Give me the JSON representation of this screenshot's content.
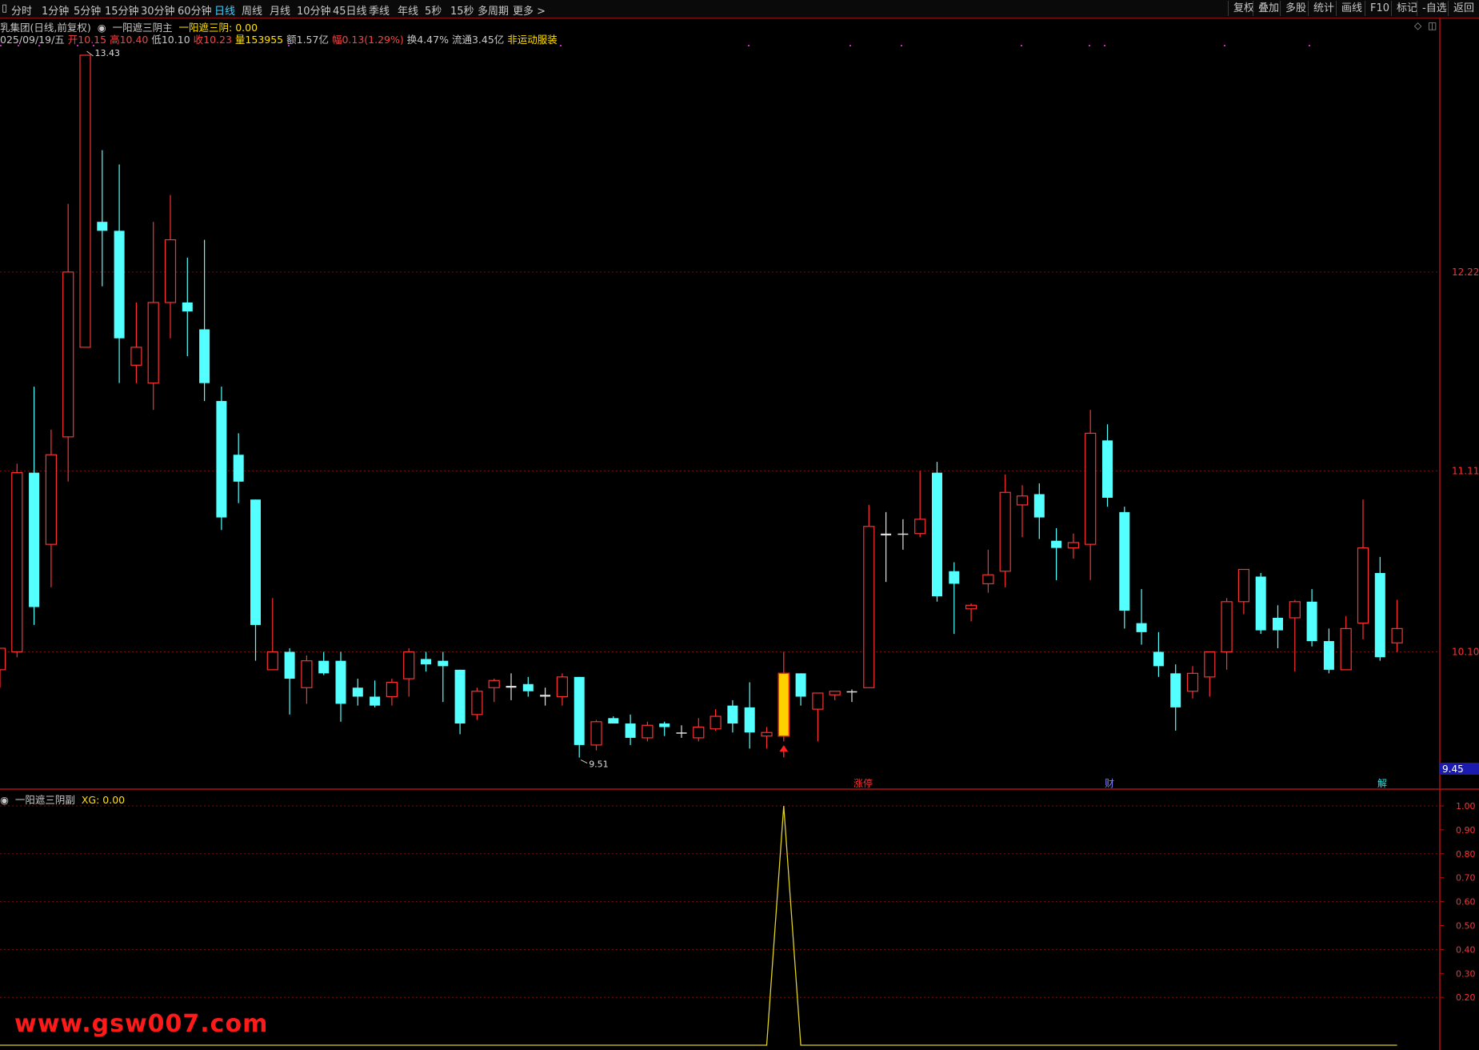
{
  "toolbar": {
    "tabs": [
      "分时",
      "1分钟",
      "5分钟",
      "15分钟",
      "30分钟",
      "60分钟",
      "日线",
      "周线",
      "月线",
      "10分钟",
      "45日线",
      "季线",
      "年线",
      "5秒",
      "15秒",
      "多周期",
      "更多 >"
    ],
    "active_tab": "日线",
    "right_buttons": [
      "复权",
      "叠加",
      "多股",
      "统计",
      "画线",
      "F10",
      "标记",
      "-自选",
      "返回"
    ]
  },
  "header": {
    "title": "乳集团(日线,前复权)",
    "indicator_main": "一阳遮三阴主",
    "indicator_value_label": "一阳遮三阴: 0.00",
    "date": "025/09/19/五",
    "open_label": "开10.15",
    "high_label": "高10.40",
    "low_label": "低10.10",
    "close_label": "收10.23",
    "volume_label": "量153955",
    "amount_label": "额1.57亿",
    "change_label": "幅0.13(1.29%)",
    "turnover_label": "换4.47%",
    "float_label": "流通3.45亿",
    "concept_label": "非运动服装"
  },
  "price_axis": {
    "labels": [
      "12.22",
      "11.11",
      "10.10"
    ],
    "current_price_tag": "9.45",
    "max_marker": "13.43",
    "min_marker": "9.51"
  },
  "event_tags": [
    "涨停",
    "财",
    "解"
  ],
  "sub_panel": {
    "title": "一阳遮三阴副",
    "value_label": "XG: 0.00",
    "axis_labels": [
      "1.00",
      "0.90",
      "0.80",
      "0.70",
      "0.60",
      "0.50",
      "0.40",
      "0.30",
      "0.20"
    ]
  },
  "watermark": "www.gsw007.com",
  "colors": {
    "up": "#ff3030",
    "down": "#54ffff",
    "signal": "#ffd000",
    "grid": "#7a0e0e"
  },
  "chart_data": {
    "type": "candlestick",
    "price_range": [
      9.3,
      13.5
    ],
    "candles": [
      {
        "o": 10.0,
        "h": 10.12,
        "l": 9.9,
        "c": 10.12
      },
      {
        "o": 10.1,
        "h": 11.15,
        "l": 10.07,
        "c": 11.1
      },
      {
        "o": 11.1,
        "h": 11.58,
        "l": 10.25,
        "c": 10.35
      },
      {
        "o": 10.7,
        "h": 11.34,
        "l": 10.46,
        "c": 11.2
      },
      {
        "o": 11.3,
        "h": 12.6,
        "l": 11.05,
        "c": 12.22
      },
      {
        "o": 11.8,
        "h": 13.43,
        "l": 11.8,
        "c": 13.43
      },
      {
        "o": 12.5,
        "h": 12.9,
        "l": 12.14,
        "c": 12.45
      },
      {
        "o": 12.45,
        "h": 12.82,
        "l": 11.6,
        "c": 11.85
      },
      {
        "o": 11.7,
        "h": 12.05,
        "l": 11.6,
        "c": 11.8
      },
      {
        "o": 11.6,
        "h": 12.5,
        "l": 11.45,
        "c": 12.05
      },
      {
        "o": 12.05,
        "h": 12.65,
        "l": 11.85,
        "c": 12.4
      },
      {
        "o": 12.05,
        "h": 12.3,
        "l": 11.75,
        "c": 12.0
      },
      {
        "o": 11.9,
        "h": 12.4,
        "l": 11.5,
        "c": 11.6
      },
      {
        "o": 11.5,
        "h": 11.58,
        "l": 10.78,
        "c": 10.85
      },
      {
        "o": 11.2,
        "h": 11.32,
        "l": 10.93,
        "c": 11.05
      },
      {
        "o": 10.95,
        "h": 10.95,
        "l": 10.05,
        "c": 10.25
      },
      {
        "o": 10.0,
        "h": 10.4,
        "l": 10.0,
        "c": 10.1
      },
      {
        "o": 10.1,
        "h": 10.12,
        "l": 9.75,
        "c": 9.95
      },
      {
        "o": 9.9,
        "h": 10.08,
        "l": 9.81,
        "c": 10.05
      },
      {
        "o": 10.05,
        "h": 10.1,
        "l": 9.97,
        "c": 9.98
      },
      {
        "o": 10.05,
        "h": 10.1,
        "l": 9.71,
        "c": 9.81
      },
      {
        "o": 9.9,
        "h": 9.95,
        "l": 9.8,
        "c": 9.85
      },
      {
        "o": 9.85,
        "h": 9.94,
        "l": 9.79,
        "c": 9.8
      },
      {
        "o": 9.85,
        "h": 9.95,
        "l": 9.8,
        "c": 9.93
      },
      {
        "o": 9.95,
        "h": 10.12,
        "l": 9.85,
        "c": 10.1
      },
      {
        "o": 10.06,
        "h": 10.1,
        "l": 9.99,
        "c": 10.03
      },
      {
        "o": 10.05,
        "h": 10.1,
        "l": 9.82,
        "c": 10.02
      },
      {
        "o": 10.0,
        "h": 10.0,
        "l": 9.64,
        "c": 9.7
      },
      {
        "o": 9.75,
        "h": 9.9,
        "l": 9.72,
        "c": 9.88
      },
      {
        "o": 9.9,
        "h": 9.95,
        "l": 9.82,
        "c": 9.94
      },
      {
        "o": 9.9,
        "h": 9.98,
        "l": 9.83,
        "c": 9.91
      },
      {
        "o": 9.92,
        "h": 9.96,
        "l": 9.85,
        "c": 9.88
      },
      {
        "o": 9.85,
        "h": 9.9,
        "l": 9.8,
        "c": 9.86
      },
      {
        "o": 9.85,
        "h": 9.98,
        "l": 9.8,
        "c": 9.96
      },
      {
        "o": 9.96,
        "h": 9.96,
        "l": 9.51,
        "c": 9.58
      },
      {
        "o": 9.58,
        "h": 9.72,
        "l": 9.55,
        "c": 9.71
      },
      {
        "o": 9.73,
        "h": 9.74,
        "l": 9.7,
        "c": 9.7
      },
      {
        "o": 9.7,
        "h": 9.75,
        "l": 9.58,
        "c": 9.62
      },
      {
        "o": 9.62,
        "h": 9.71,
        "l": 9.6,
        "c": 9.69
      },
      {
        "o": 9.7,
        "h": 9.71,
        "l": 9.63,
        "c": 9.68
      },
      {
        "o": 9.65,
        "h": 9.69,
        "l": 9.62,
        "c": 9.65
      },
      {
        "o": 9.62,
        "h": 9.73,
        "l": 9.6,
        "c": 9.68
      },
      {
        "o": 9.67,
        "h": 9.78,
        "l": 9.66,
        "c": 9.74
      },
      {
        "o": 9.8,
        "h": 9.83,
        "l": 9.65,
        "c": 9.7
      },
      {
        "o": 9.79,
        "h": 9.93,
        "l": 9.56,
        "c": 9.65
      },
      {
        "o": 9.63,
        "h": 9.68,
        "l": 9.56,
        "c": 9.65
      },
      {
        "o": 9.63,
        "h": 10.1,
        "l": 9.6,
        "c": 9.98,
        "highlight": true
      },
      {
        "o": 9.98,
        "h": 9.98,
        "l": 9.8,
        "c": 9.85
      },
      {
        "o": 9.78,
        "h": 9.87,
        "l": 9.6,
        "c": 9.87
      },
      {
        "o": 9.86,
        "h": 9.88,
        "l": 9.83,
        "c": 9.88
      },
      {
        "o": 9.88,
        "h": 9.89,
        "l": 9.82,
        "c": 9.88
      },
      {
        "o": 9.9,
        "h": 10.92,
        "l": 9.9,
        "c": 10.8
      },
      {
        "o": 10.76,
        "h": 10.88,
        "l": 10.49,
        "c": 10.75
      },
      {
        "o": 10.76,
        "h": 10.84,
        "l": 10.67,
        "c": 10.76
      },
      {
        "o": 10.76,
        "h": 11.11,
        "l": 10.74,
        "c": 10.84
      },
      {
        "o": 11.1,
        "h": 11.16,
        "l": 10.38,
        "c": 10.41
      },
      {
        "o": 10.55,
        "h": 10.6,
        "l": 10.2,
        "c": 10.48
      },
      {
        "o": 10.34,
        "h": 10.37,
        "l": 10.27,
        "c": 10.36
      },
      {
        "o": 10.48,
        "h": 10.67,
        "l": 10.43,
        "c": 10.53
      },
      {
        "o": 10.55,
        "h": 11.09,
        "l": 10.46,
        "c": 10.99
      },
      {
        "o": 10.92,
        "h": 11.03,
        "l": 10.74,
        "c": 10.97
      },
      {
        "o": 10.98,
        "h": 11.04,
        "l": 10.73,
        "c": 10.85
      },
      {
        "o": 10.72,
        "h": 10.79,
        "l": 10.5,
        "c": 10.68
      },
      {
        "o": 10.68,
        "h": 10.76,
        "l": 10.62,
        "c": 10.71
      },
      {
        "o": 10.7,
        "h": 11.45,
        "l": 10.5,
        "c": 11.32
      },
      {
        "o": 11.28,
        "h": 11.37,
        "l": 10.91,
        "c": 10.96
      },
      {
        "o": 10.88,
        "h": 10.91,
        "l": 10.23,
        "c": 10.33
      },
      {
        "o": 10.26,
        "h": 10.45,
        "l": 10.14,
        "c": 10.21
      },
      {
        "o": 10.1,
        "h": 10.21,
        "l": 9.96,
        "c": 10.02
      },
      {
        "o": 9.98,
        "h": 10.03,
        "l": 9.66,
        "c": 9.79
      },
      {
        "o": 9.88,
        "h": 10.02,
        "l": 9.84,
        "c": 9.98
      },
      {
        "o": 9.96,
        "h": 10.04,
        "l": 9.85,
        "c": 10.1
      },
      {
        "o": 10.1,
        "h": 10.4,
        "l": 10.0,
        "c": 10.38
      },
      {
        "o": 10.38,
        "h": 10.53,
        "l": 10.31,
        "c": 10.56
      },
      {
        "o": 10.52,
        "h": 10.54,
        "l": 10.2,
        "c": 10.22
      },
      {
        "o": 10.29,
        "h": 10.36,
        "l": 10.12,
        "c": 10.22
      },
      {
        "o": 10.29,
        "h": 10.39,
        "l": 9.99,
        "c": 10.38
      },
      {
        "o": 10.38,
        "h": 10.45,
        "l": 10.13,
        "c": 10.16
      },
      {
        "o": 10.16,
        "h": 10.23,
        "l": 9.98,
        "c": 10.0
      },
      {
        "o": 10.0,
        "h": 10.3,
        "l": 10.0,
        "c": 10.23
      },
      {
        "o": 10.26,
        "h": 10.95,
        "l": 10.17,
        "c": 10.68
      },
      {
        "o": 10.54,
        "h": 10.63,
        "l": 10.05,
        "c": 10.07
      },
      {
        "o": 10.15,
        "h": 10.39,
        "l": 10.1,
        "c": 10.23
      }
    ],
    "signal": {
      "series": "XG",
      "spike_index": 46,
      "spike_value": 1.0,
      "baseline": 0.0
    }
  }
}
